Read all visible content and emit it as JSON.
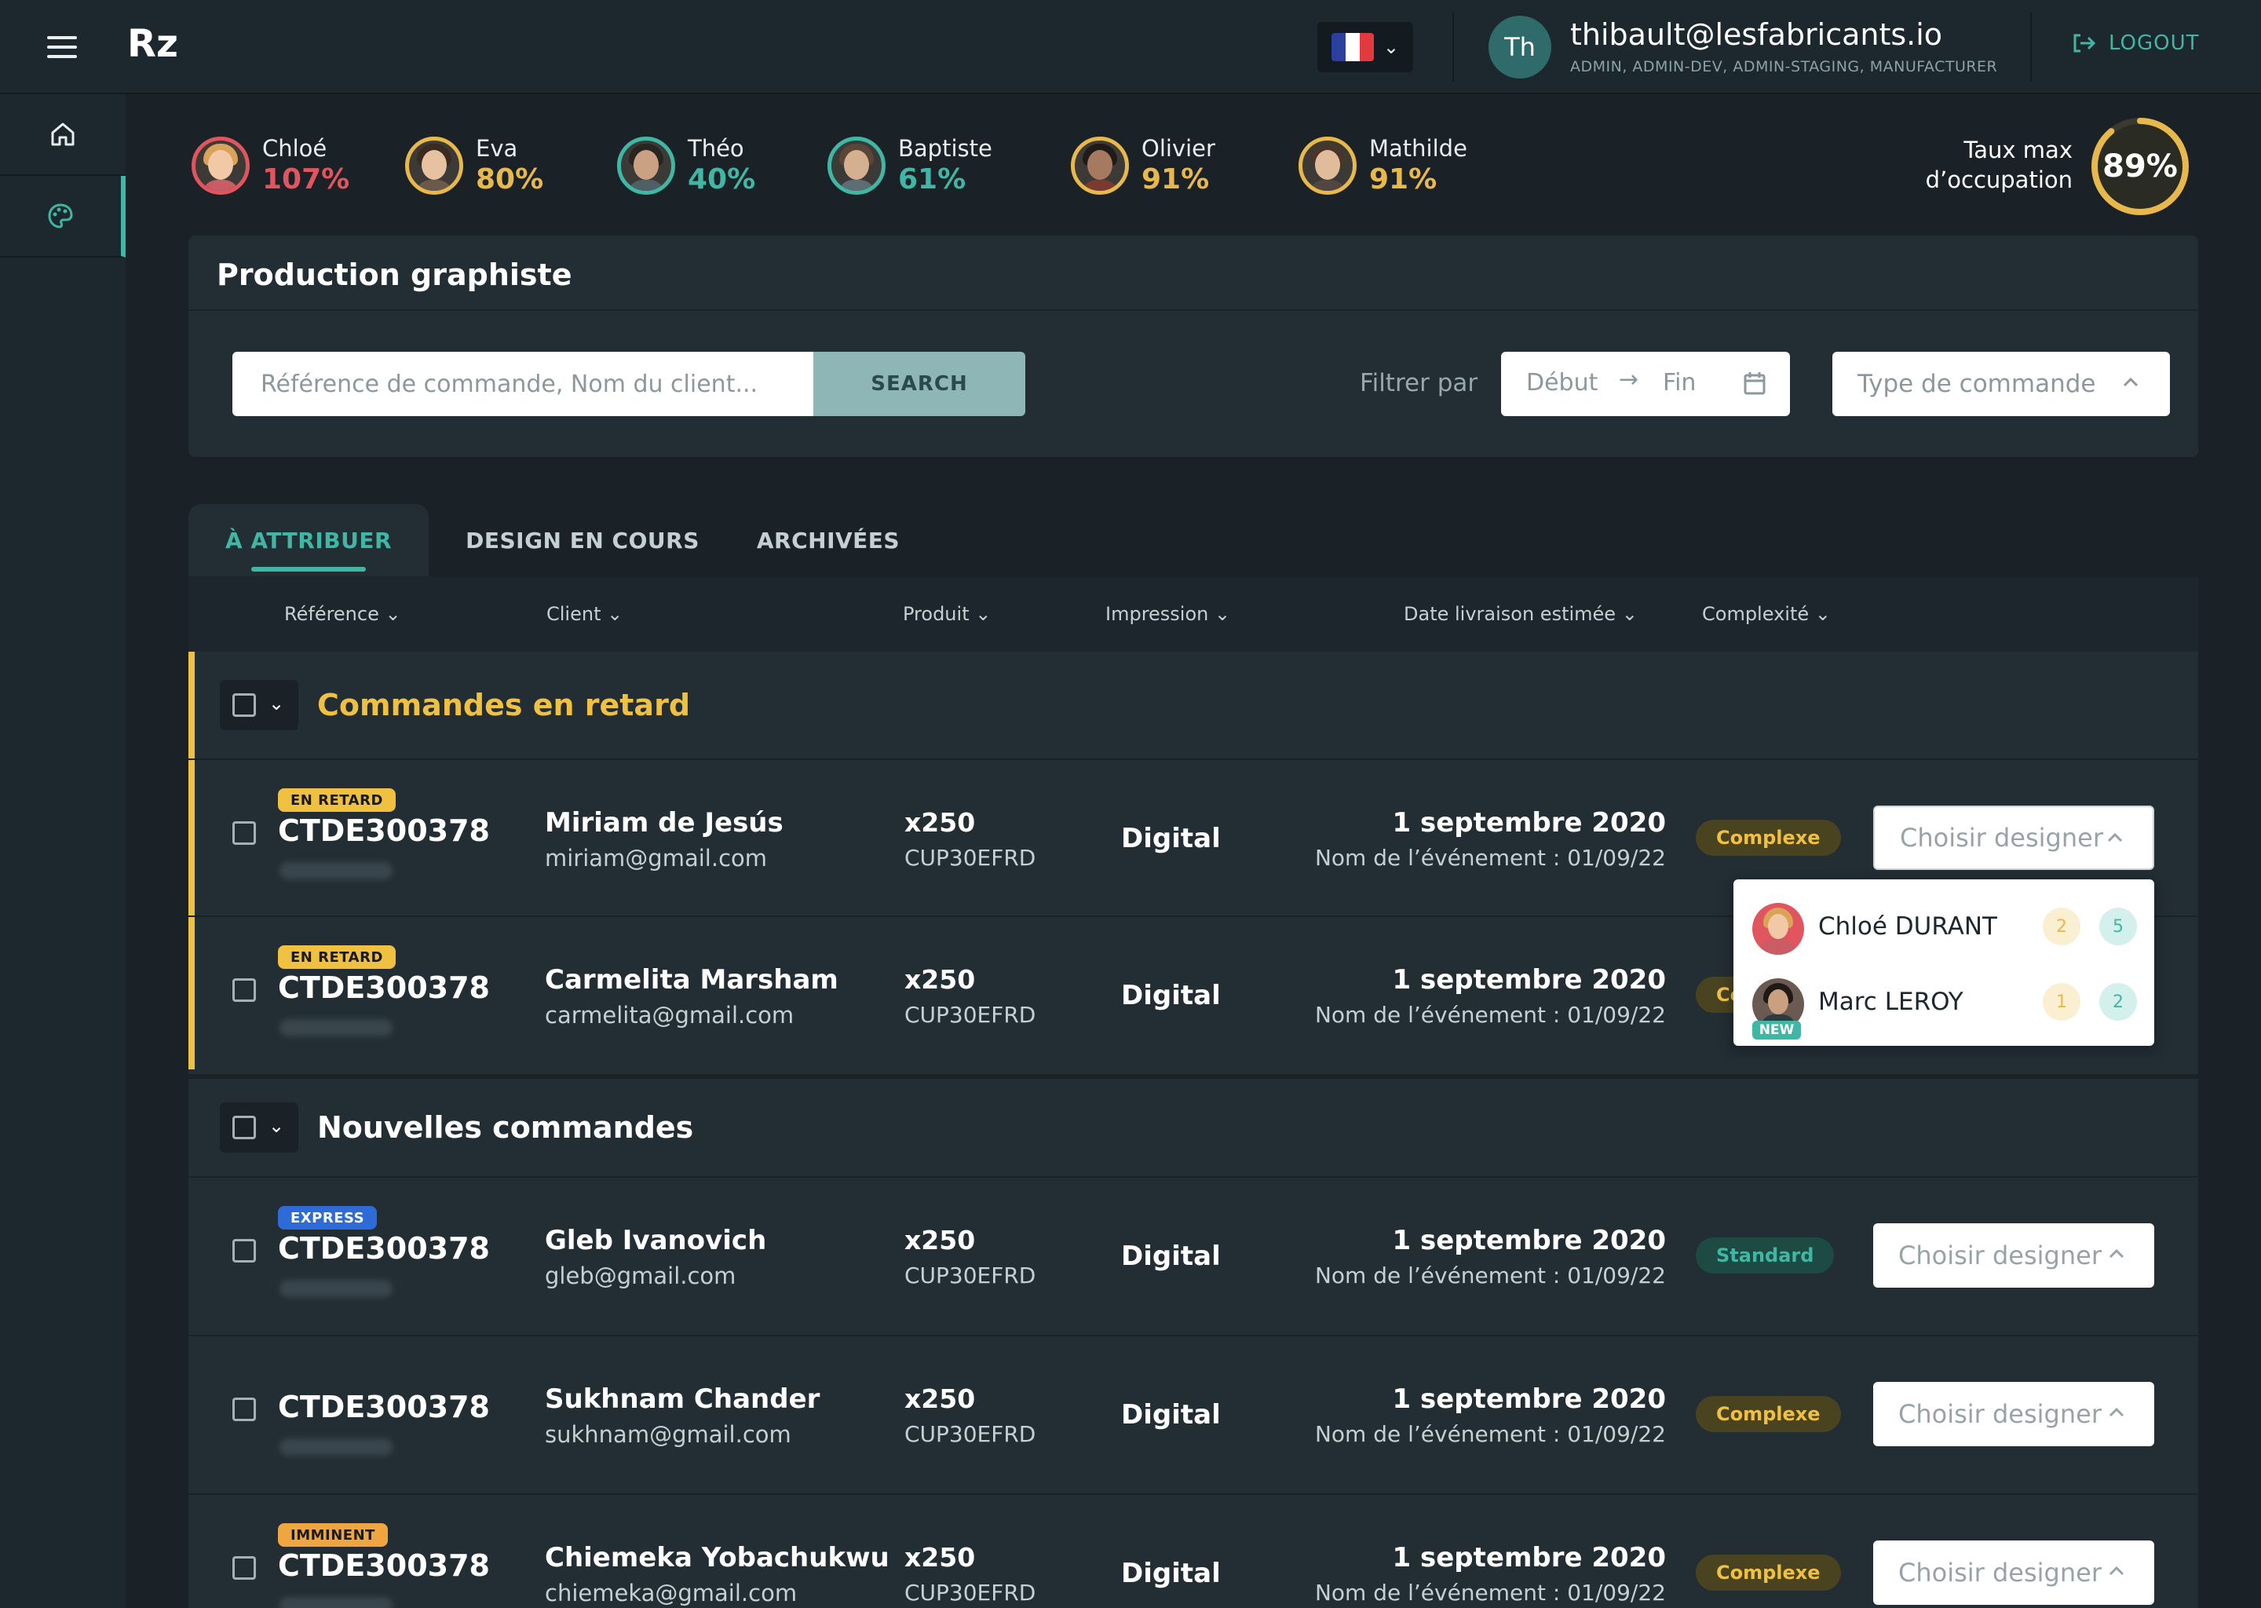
{
  "app": {
    "logo": "Rz",
    "language": "FR"
  },
  "colors": {
    "accent": "#3fb7a4",
    "late": "#f0c040",
    "over": "#e0555e",
    "bg": "#1a2228",
    "panel": "#222d34"
  },
  "user": {
    "initials": "Th",
    "email": "thibault@lesfabricants.io",
    "roles": "ADMIN, ADMIN-DEV, ADMIN-STAGING, MANUFACTURER",
    "logout_label": "LOGOUT"
  },
  "sidebar": {
    "items": [
      {
        "icon": "home-icon"
      },
      {
        "icon": "palette-icon"
      }
    ]
  },
  "designers": [
    {
      "name": "Chloé",
      "pct": "107%"
    },
    {
      "name": "Eva",
      "pct": "80%"
    },
    {
      "name": "Théo",
      "pct": "40%"
    },
    {
      "name": "Baptiste",
      "pct": "61%"
    },
    {
      "name": "Olivier",
      "pct": "91%"
    },
    {
      "name": "Mathilde",
      "pct": "91%"
    }
  ],
  "occupancy": {
    "label": "Taux max d’occupation",
    "value": "89%",
    "fraction": 0.89
  },
  "panel": {
    "title": "Production graphiste",
    "search_placeholder": "Référence de commande, Nom du client...",
    "search_button": "SEARCH",
    "filter_label": "Filtrer par",
    "date_start": "Début",
    "date_end": "Fin",
    "type_placeholder": "Type de commande"
  },
  "tabs": [
    {
      "label": "À ATTRIBUER"
    },
    {
      "label": "DESIGN EN COURS"
    },
    {
      "label": "ARCHIVÉES"
    }
  ],
  "columns": [
    "Référence",
    "Client",
    "Produit",
    "Impression",
    "Date livraison estimée",
    "Complexité"
  ],
  "groups": [
    {
      "title": "Commandes en retard",
      "rows": [
        {
          "badge": "EN RETARD",
          "ref": "CTDE300378",
          "client": "Miriam de Jesús",
          "email": "miriam@gmail.com",
          "qty": "x250",
          "sku": "CUP30EFRD",
          "impression": "Digital",
          "date": "1 septembre 2020",
          "event": "Nom de l’événement : 01/09/22",
          "complexity": "Complexe",
          "choose": "Choisir designer"
        },
        {
          "badge": "EN RETARD",
          "ref": "CTDE300378",
          "client": "Carmelita Marsham",
          "email": "carmelita@gmail.com",
          "qty": "x250",
          "sku": "CUP30EFRD",
          "impression": "Digital",
          "date": "1 septembre 2020",
          "event": "Nom de l’événement : 01/09/22",
          "complexity": "Co"
        }
      ]
    },
    {
      "title": "Nouvelles commandes",
      "rows": [
        {
          "badge": "EXPRESS",
          "ref": "CTDE300378",
          "client": "Gleb Ivanovich",
          "email": "gleb@gmail.com",
          "qty": "x250",
          "sku": "CUP30EFRD",
          "impression": "Digital",
          "date": "1 septembre 2020",
          "event": "Nom de l’événement : 01/09/22",
          "complexity": "Standard",
          "choose": "Choisir designer"
        },
        {
          "badge": "",
          "ref": "CTDE300378",
          "client": "Sukhnam Chander",
          "email": "sukhnam@gmail.com",
          "qty": "x250",
          "sku": "CUP30EFRD",
          "impression": "Digital",
          "date": "1 septembre 2020",
          "event": "Nom de l’événement : 01/09/22",
          "complexity": "Complexe",
          "choose": "Choisir designer"
        },
        {
          "badge": "IMMINENT",
          "ref": "CTDE300378",
          "client": "Chiemeka Yobachukwu",
          "email": "chiemeka@gmail.com",
          "qty": "x250",
          "sku": "CUP30EFRD",
          "impression": "Digital",
          "date": "1 septembre 2020",
          "event": "Nom de l’événement : 01/09/22",
          "complexity": "Complexe",
          "choose": "Choisir designer"
        }
      ]
    }
  ],
  "dropdown": {
    "items": [
      {
        "name": "Chloé DURANT",
        "a": "2",
        "b": "5"
      },
      {
        "name": "Marc LEROY",
        "a": "1",
        "b": "2",
        "badge": "NEW"
      }
    ]
  }
}
